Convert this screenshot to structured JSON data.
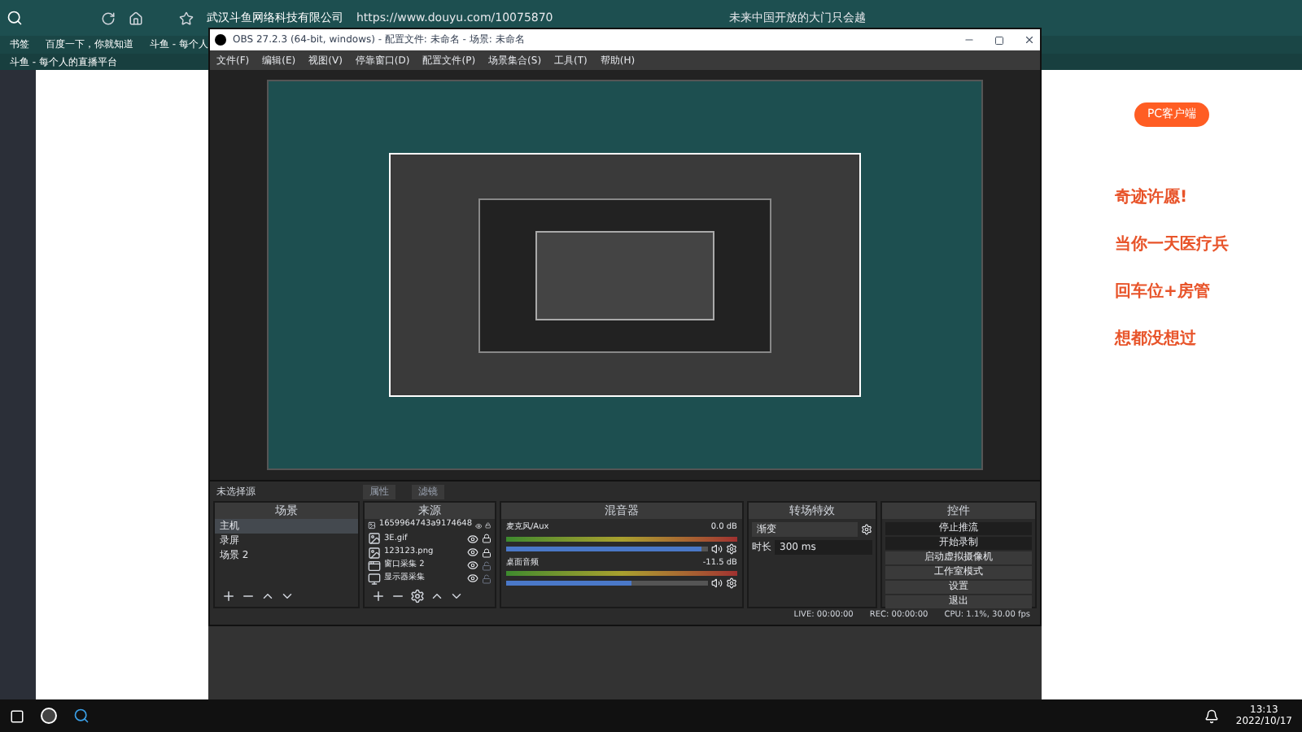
{
  "browser": {
    "site_name": "武汉斗鱼网络科技有限公司",
    "url": "https://www.douyu.com/10075870",
    "news": "未来中国开放的大门只会越",
    "bookmarks": [
      "书签",
      "百度一下，你就知道",
      "斗鱼 - 每个人"
    ],
    "page_tab": "斗鱼 - 每个人的直播平台"
  },
  "obs": {
    "title": "OBS 27.2.3 (64-bit, windows) - 配置文件: 未命名 - 场景: 未命名",
    "menu": [
      "文件(F)",
      "编辑(E)",
      "视图(V)",
      "停靠窗口(D)",
      "配置文件(P)",
      "场景集合(S)",
      "工具(T)",
      "帮助(H)"
    ],
    "source_bar": {
      "label": "未选择源",
      "buttons": [
        "属性",
        "滤镜"
      ]
    },
    "scenes": {
      "title": "场景",
      "items": [
        {
          "name": "主机",
          "selected": true
        },
        {
          "name": "录屏",
          "selected": false
        },
        {
          "name": "场景 2",
          "selected": false
        }
      ]
    },
    "sources": {
      "title": "来源",
      "items": [
        {
          "name": "1659964743a9174648",
          "kind": "image",
          "visible": true,
          "locked": true
        },
        {
          "name": "3E.gif",
          "kind": "image",
          "visible": true,
          "locked": true
        },
        {
          "name": "123123.png",
          "kind": "image",
          "visible": true,
          "locked": true
        },
        {
          "name": "窗口采集 2",
          "kind": "window",
          "visible": true,
          "locked": false
        },
        {
          "name": "显示器采集",
          "kind": "display",
          "visible": true,
          "locked": false
        }
      ]
    },
    "mixer": {
      "title": "混音器",
      "channels": [
        {
          "name": "麦克风/Aux",
          "reading": "0.0 dB",
          "level": 0.97
        },
        {
          "name": "桌面音频",
          "reading": "-11.5 dB",
          "level": 0.62
        }
      ]
    },
    "transitions": {
      "title": "转场特效",
      "type": "渐变",
      "duration_label": "时长",
      "duration": "300 ms"
    },
    "controls": {
      "title": "控件",
      "buttons": [
        {
          "label": "停止推流",
          "active": true
        },
        {
          "label": "开始录制",
          "active": true
        },
        {
          "label": "启动虚拟摄像机",
          "active": false
        },
        {
          "label": "工作室模式",
          "active": false
        },
        {
          "label": "设置",
          "active": false
        },
        {
          "label": "退出",
          "active": false
        }
      ]
    },
    "status": [
      "LIVE: 00:00:00",
      "REC: 00:00:00",
      "CPU: 1.1%, 30.00 fps"
    ]
  },
  "douyu": {
    "client_button": "PC客户端",
    "banners": [
      "奇迹许愿!",
      "当你一天医疗兵",
      "回车位+房管",
      "想都没想过"
    ]
  },
  "taskbar": {
    "time": "13:13",
    "date": "2022/10/17"
  }
}
